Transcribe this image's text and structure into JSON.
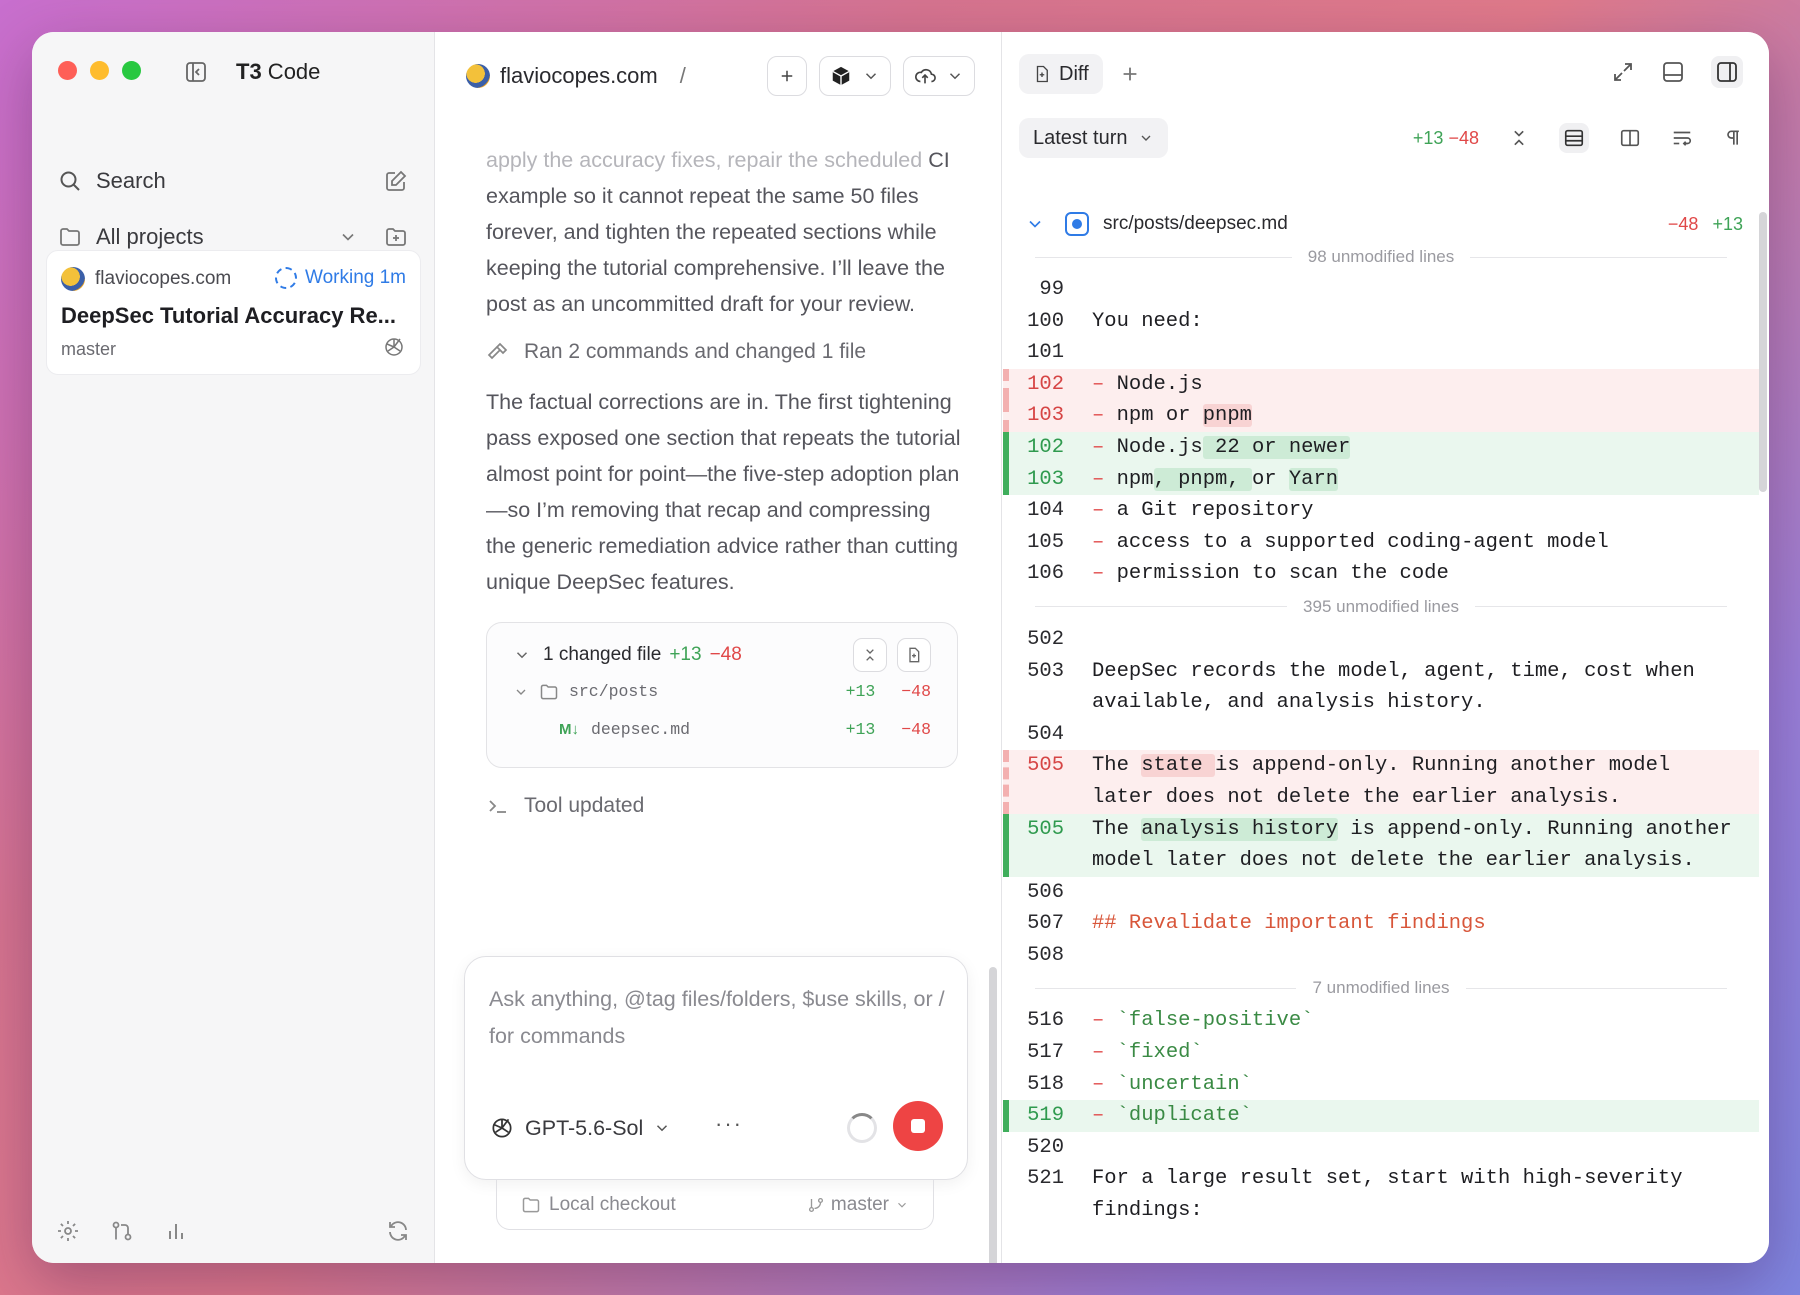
{
  "app": {
    "title_bold": "T3",
    "title_rest": " Code"
  },
  "sidebar": {
    "search_label": "Search",
    "projects_label": "All projects",
    "project": {
      "site": "flaviocopes.com",
      "status": "Working 1m",
      "thread_title": "DeepSec Tutorial Accuracy Re...",
      "branch": "master"
    }
  },
  "chat": {
    "breadcrumb": "flaviocopes.com",
    "breadcrumb_sep": "/",
    "msg1_faded": "apply the accuracy fixes, repair the scheduled",
    "msg1": "CI example so it cannot repeat the same 50 files forever, and tighten the repeated sections while keeping the tutorial comprehensive. I’ll leave the post as an uncommitted draft for your review.",
    "tool1": "Ran 2 commands and changed 1 file",
    "msg2": "The factual corrections are in. The first tightening pass exposed one section that repeats the tutorial almost point for point—the five-step adoption plan—so I’m removing that recap and compressing the generic remediation advice rather than cutting unique DeepSec features.",
    "changes": {
      "title": "1 changed file",
      "plus": "+13",
      "minus": "−48",
      "folder": "src/posts",
      "folder_plus": "+13",
      "folder_minus": "−48",
      "file_badge": "M↓",
      "file": "deepsec.md",
      "file_plus": "+13",
      "file_minus": "−48"
    },
    "tool2": "Tool updated",
    "composer": {
      "placeholder": "Ask anything, @tag files/folders, $use skills, or / for commands",
      "model": "GPT-5.6-Sol",
      "more": "···"
    },
    "checkout": {
      "label": "Local checkout",
      "branch": "master"
    }
  },
  "diff": {
    "tab": "Diff",
    "turn": "Latest turn",
    "turn_plus": "+13",
    "turn_minus": "−48",
    "file": "src/posts/deepsec.md",
    "file_minus": "−48",
    "file_plus": "+13",
    "sep1": "98 unmodified lines",
    "sep2": "395 unmodified lines",
    "sep3": "7 unmodified lines",
    "lines": {
      "l99": "99",
      "l100": "100",
      "t100": "You need:",
      "l101": "101",
      "d102": "102",
      "d102t": "Node.js",
      "d103": "103",
      "d103a": "npm or ",
      "d103b": "pnpm",
      "a102": "102",
      "a102a": "Node.js",
      "a102b": " 22 or newer",
      "a103": "103",
      "a103a": "npm",
      "a103b": ", pnpm, ",
      "a103c": "or ",
      "a103d": "Yarn",
      "l104": "104",
      "t104": "a Git repository",
      "l105": "105",
      "t105": "access to a supported coding-agent model",
      "l106": "106",
      "t106": "permission to scan the code",
      "l502": "502",
      "l503": "503",
      "t503": "DeepSec records the model, agent, time, cost when available, and analysis history.",
      "l504": "504",
      "d505": "505",
      "d505a": "The ",
      "d505b": "state ",
      "d505c": "is append-only. Running another model later does not delete the earlier analysis.",
      "a505": "505",
      "a505a": "The ",
      "a505b": "analysis history",
      "a505c": " is append-only. Running another model later does not delete the earlier analysis.",
      "l506": "506",
      "l507": "507",
      "t507": "## Revalidate important findings",
      "l508": "508",
      "l516": "516",
      "t516": "`false-positive`",
      "l517": "517",
      "t517": "`fixed`",
      "l518": "518",
      "t518": "`uncertain`",
      "a519": "519",
      "t519": "`duplicate`",
      "l520": "520",
      "l521": "521",
      "t521": "For a large result set, start with high-severity findings:",
      "dash": "– "
    }
  }
}
